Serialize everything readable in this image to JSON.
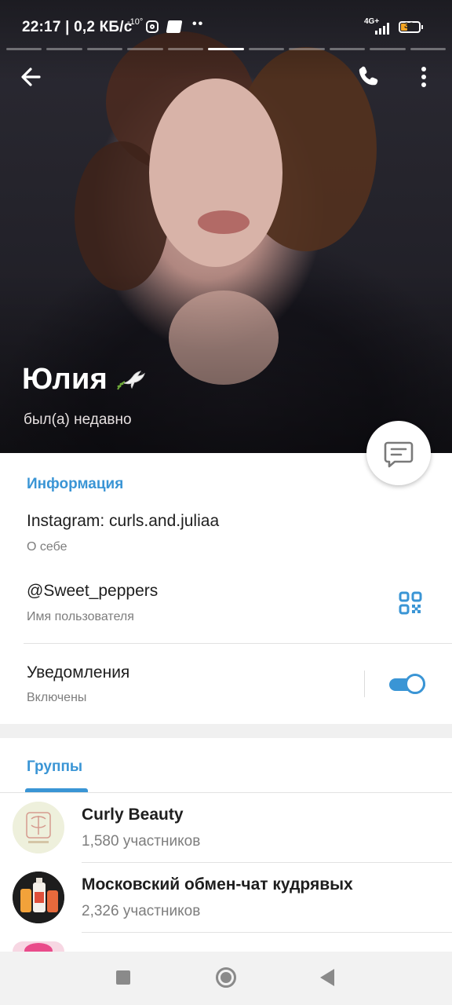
{
  "status_bar": {
    "time": "22:17",
    "separator": "|",
    "speed": "0,2 КБ/с",
    "temperature": "-10°",
    "network": "4G+",
    "battery": "38",
    "battery_level": 0.38
  },
  "story_progress": {
    "segments": 11,
    "active_index": 5
  },
  "profile": {
    "name": "Юлия",
    "last_seen": "был(а) недавно"
  },
  "info": {
    "section_title": "Информация",
    "bio_value": "Instagram: curls.and.juliaa",
    "bio_label": "О себе",
    "username_value": "@Sweet_peppers",
    "username_label": "Имя пользователя",
    "notifications_label": "Уведомления",
    "notifications_state": "Включены",
    "notifications_on": true
  },
  "groups": {
    "tab_title": "Группы",
    "items": [
      {
        "name": "Curly Beauty",
        "members": "1,580 участников"
      },
      {
        "name": "Московский обмен-чат кудрявых",
        "members": "2,326 участников"
      }
    ]
  },
  "colors": {
    "accent": "#3a95d5",
    "text_primary": "#1e1e1e",
    "text_secondary": "#7d7d7d"
  }
}
